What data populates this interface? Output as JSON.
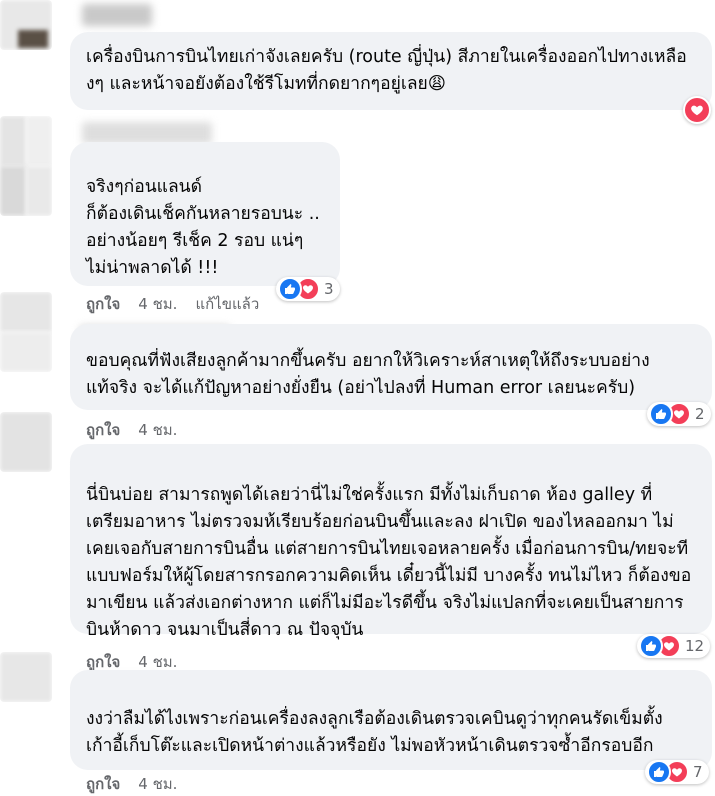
{
  "comments": [
    {
      "text": "เครื่องบินการบินไทยเก่าจังเลยครับ (route ญี่ปุ่น) สีภายในเครื่องออกไปทางเหลืองๆ และหน้าจอยังต้องใช้รีโมทที่กดยากๆอยู่เลย😩",
      "reaction_count": ""
    },
    {
      "text": "จริงๆก่อนแลนด์\nก็ต้องเดินเช็คกันหลายรอบนะ ..\nอย่างน้อยๆ รีเช็ค 2 รอบ แน่ๆ\nไม่น่าพลาดได้ !!!",
      "reaction_count": "3",
      "like_label": "ถูกใจ",
      "time": "4 ชม.",
      "edited": "แก้ไขแล้ว"
    },
    {
      "text": "ขอบคุณที่ฟังเสียงลูกค้ามากขึ้นครับ อยากให้วิเคราะห์สาเหตุให้ถึงระบบอย่างแท้จริง จะได้แก้ปัญหาอย่างยั่งยืน (อย่าไปลงที่ Human error เลยนะครับ)",
      "reaction_count": "2",
      "like_label": "ถูกใจ",
      "time": "4 ชม."
    },
    {
      "text": "นี่บินบ่อย สามารถพูดได้เลยว่านี่ไม่ใช่ครั้งแรก มีทั้งไม่เก็บถาด ห้อง galley ที่เตรียมอาหาร ไม่ตรวจมห้เรียบร้อยก่อนบินขึ้นและลง ฝาเปิด ของไหลออกมา ไม่เคยเจอกับสายการบินอื่น แต่สายการบินไทยเจอหลายครั้ง เมื่อก่อนการบิน/ทยจะทีแบบฟอร์มให้ผู้โดยสารกรอกความคิดเห็น เดี๋ยวนี้ไม่มี บางครั้ง ทนไม่ไหว ก็ต้องขอมาเขียน แล้วส่งเอกต่างหาก แต่ก็ไม่มีอะไรดีขึ้น จริงไม่แปลกที่จะเคยเป็นสายการบินห้าดาว จนมาเป็นสี่ดาว ณ ปัจจุบัน",
      "reaction_count": "12",
      "like_label": "ถูกใจ",
      "time": "4 ชม."
    },
    {
      "text": "งงว่าลืมได้ไงเพราะก่อนเครื่องลงลูกเรือต้องเดินตรวจเคบินดูว่าทุกคนรัดเข็มตั้งเก้าอี้เก็บโต๊ะและเปิดหน้าต่างแล้วหรือยัง ไม่พอหัวหน้าเดินตรวจซ้ำอีกรอบอีก",
      "reaction_count": "7",
      "like_label": "ถูกใจ",
      "time": "4 ชม."
    }
  ]
}
